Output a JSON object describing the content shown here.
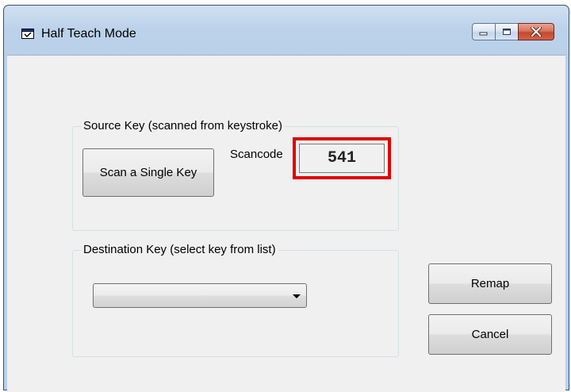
{
  "window": {
    "title": "Half Teach Mode"
  },
  "caption_buttons": {
    "minimize_icon": "minimize-icon",
    "maximize_icon": "maximize-icon",
    "close_icon": "close-icon"
  },
  "source_group": {
    "label": "Source Key (scanned from keystroke)",
    "scan_button_label": "Scan a Single Key",
    "scancode_label": "Scancode",
    "scancode_value": "541",
    "highlight_color": "#e00000"
  },
  "destination_group": {
    "label": "Destination Key (select key from list)",
    "selected_value": ""
  },
  "actions": {
    "remap_label": "Remap",
    "cancel_label": "Cancel"
  }
}
